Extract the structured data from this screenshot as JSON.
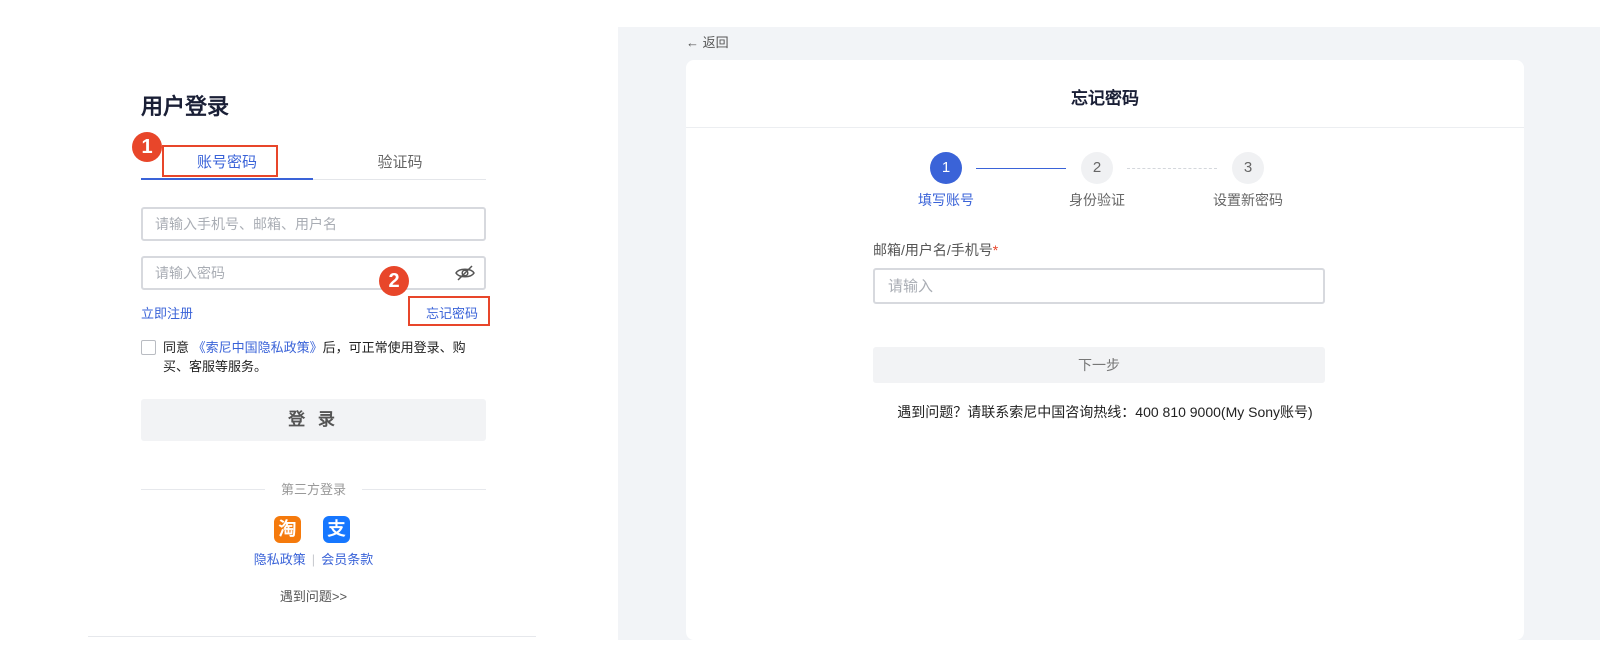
{
  "login": {
    "title": "用户登录",
    "tabs": [
      {
        "label": "账号密码",
        "active": true
      },
      {
        "label": "验证码",
        "active": false
      }
    ],
    "account_placeholder": "请输入手机号、邮箱、用户名",
    "password_placeholder": "请输入密码",
    "register_link": "立即注册",
    "forgot_link": "忘记密码",
    "agree_prefix": "同意",
    "agree_policy": "《索尼中国隐私政策》",
    "agree_suffix": "后，可正常使用登录、购买、客服等服务。",
    "login_button": "登 录",
    "third_party_label": "第三方登录",
    "third_party_icons": [
      {
        "name": "taobao-icon",
        "glyph": "淘",
        "color": "#f57a0c"
      },
      {
        "name": "alipay-icon",
        "glyph": "支",
        "color": "#1677ff"
      }
    ],
    "privacy_link": "隐私政策",
    "terms_link": "会员条款",
    "trouble_link": "遇到问题>>"
  },
  "annotations": {
    "marker_1": "1",
    "marker_2": "2",
    "highlight_color": "#e8462a"
  },
  "forgot": {
    "back_label": "返回",
    "title": "忘记密码",
    "steps": [
      {
        "num": "1",
        "label": "填写账号",
        "active": true
      },
      {
        "num": "2",
        "label": "身份验证",
        "active": false
      },
      {
        "num": "3",
        "label": "设置新密码",
        "active": false
      }
    ],
    "field_label": "邮箱/用户名/手机号",
    "required_mark": "*",
    "field_placeholder": "请输入",
    "next_button": "下一步",
    "hotline": "遇到问题？请联系索尼中国咨询热线：400 810 9000(My Sony账号)"
  },
  "colors": {
    "accent": "#3a63d8",
    "background_right": "#f2f4f7"
  }
}
